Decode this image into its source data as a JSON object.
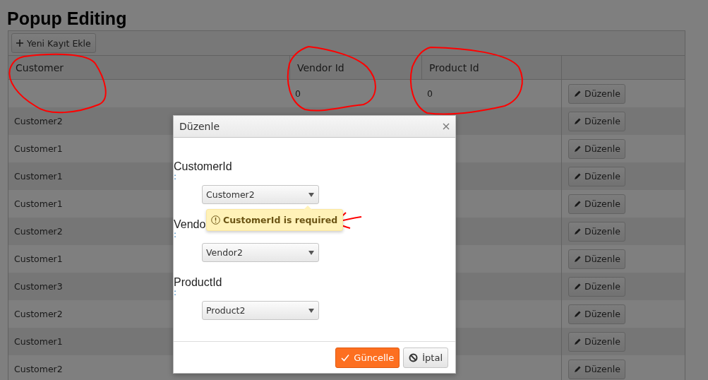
{
  "page_title": "Popup Editing",
  "toolbar": {
    "add_button": "Yeni Kayıt Ekle"
  },
  "grid": {
    "columns": [
      "Customer",
      "Vendor Id",
      "Product Id"
    ],
    "rows": [
      {
        "vendor_id": "0",
        "product_id": "0",
        "action": "Düzenle"
      },
      {
        "customer": "Customer2",
        "action": "Düzenle"
      },
      {
        "customer": "Customer1",
        "action": "Düzenle"
      },
      {
        "customer": "Customer1",
        "action": "Düzenle"
      },
      {
        "customer": "Customer1",
        "action": "Düzenle"
      },
      {
        "customer": "Customer2",
        "action": "Düzenle"
      },
      {
        "customer": "Customer1",
        "action": "Düzenle"
      },
      {
        "customer": "Customer3",
        "action": "Düzenle"
      },
      {
        "customer": "Customer2",
        "action": "Düzenle"
      },
      {
        "customer": "Customer1",
        "action": "Düzenle"
      },
      {
        "customer": "Customer2",
        "action": "Düzenle"
      }
    ]
  },
  "dialog": {
    "title": "Düzenle",
    "fields": [
      {
        "label": "CustomerId",
        "separator": ":",
        "value": "Customer2",
        "error": "CustomerId is required"
      },
      {
        "label": "Vendo",
        "separator": ":",
        "value": "Vendor2"
      },
      {
        "label": "ProductId",
        "separator": ":",
        "value": "Product2"
      }
    ],
    "buttons": [
      {
        "kind": "primary",
        "label": "Güncelle"
      },
      {
        "kind": "cancel",
        "label": "İptal"
      }
    ]
  }
}
